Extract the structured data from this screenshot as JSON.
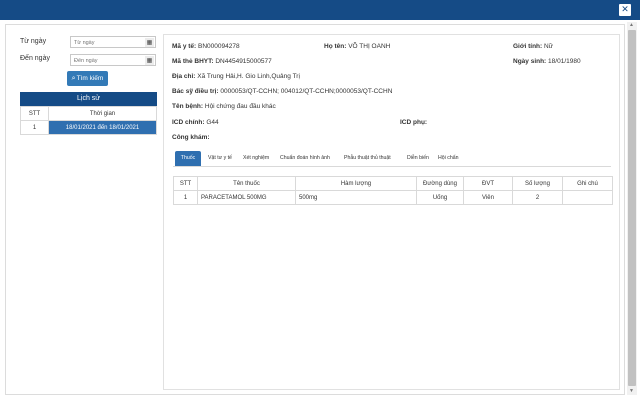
{
  "window": {
    "close_icon": "close-icon"
  },
  "filters": {
    "from_label": "Từ ngày",
    "from_placeholder": "Từ ngày",
    "to_label": "Đến ngày",
    "to_placeholder": "Đến ngày",
    "search_label": "Tìm kiếm"
  },
  "history": {
    "title": "Lịch sử",
    "columns": [
      "STT",
      "Thời gian"
    ],
    "rows": [
      {
        "stt": "1",
        "time": "18/01/2021 đến 18/01/2021"
      }
    ]
  },
  "patient": {
    "medical_id_label": "Mã y tế:",
    "medical_id": "BN000094278",
    "name_label": "Họ tên:",
    "name": "VÕ THỊ OANH",
    "gender_label": "Giới tính:",
    "gender": "Nữ",
    "insurance_label": "Mã thẻ BHYT:",
    "insurance": "DN4454915000577",
    "dob_label": "Ngày sinh:",
    "dob": "18/01/1980",
    "address_label": "Địa chỉ:",
    "address": "Xã Trung Hải,H. Gio Linh,Quảng Trị",
    "doctor_label": "Bác sỹ điều trị:",
    "doctor": "0000053/QT-CCHN; 004012/QT-CCHN;0000053/QT-CCHN",
    "disease_label": "Tên bệnh:",
    "disease": "Hội chứng đau đầu khác",
    "icd_main_label": "ICD chính:",
    "icd_main": "G44",
    "icd_sub_label": "ICD phụ:",
    "icd_sub": "",
    "exam_label": "Công khám:",
    "exam": ""
  },
  "tabs": [
    "Thuốc",
    "Vật tư y tế",
    "Xét nghiệm",
    "Chuẩn đoán hình ảnh",
    "Phẫu thuật thủ thuật",
    "Diễn biến",
    "Hội chẩn"
  ],
  "drug_table": {
    "columns": [
      "STT",
      "Tên thuốc",
      "Hàm lượng",
      "Đường dùng",
      "ĐVT",
      "Số lượng",
      "Ghi chú"
    ],
    "rows": [
      {
        "stt": "1",
        "name": "PARACETAMOL 500MG",
        "strength": "500mg",
        "route": "Uống",
        "unit": "Viên",
        "qty": "2",
        "note": ""
      }
    ]
  }
}
